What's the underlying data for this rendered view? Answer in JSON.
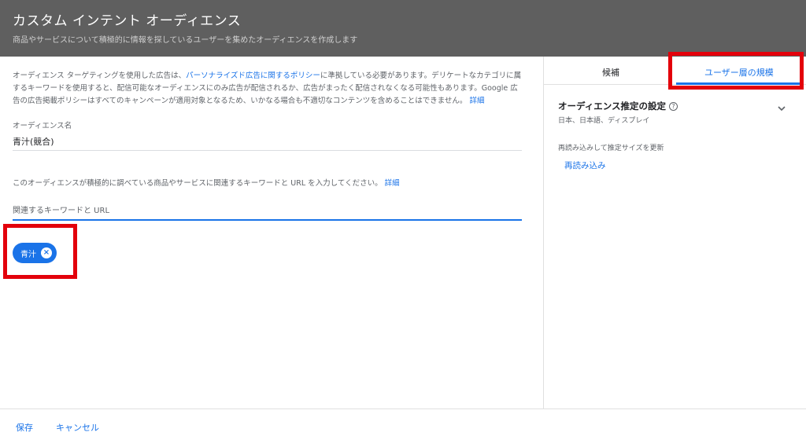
{
  "header": {
    "title": "カスタム インテント オーディエンス",
    "subtitle": "商品やサービスについて積極的に情報を探しているユーザーを集めたオーディエンスを作成します"
  },
  "policy": {
    "text_before": "オーディエンス ターゲティングを使用した広告は、",
    "link": "パーソナライズド広告に関するポリシー",
    "text_after": "に準拠している必要があります。デリケートなカテゴリに属するキーワードを使用すると、配信可能なオーディエンスにのみ広告が配信されるか、広告がまったく配信されなくなる可能性もあります。Google 広告の広告掲載ポリシーはすべてのキャンペーンが適用対象となるため、いかなる場合も不適切なコンテンツを含めることはできません。",
    "details_link": "詳細"
  },
  "audience_name": {
    "label": "オーディエンス名",
    "value": "青汁(競合)"
  },
  "keywords": {
    "instruction": "このオーディエンスが積極的に調べている商品やサービスに関連するキーワードと URL を入力してください。",
    "details_link": "詳細",
    "placeholder": "関連するキーワードと URL",
    "chips": [
      {
        "label": "青汁"
      }
    ]
  },
  "side": {
    "tabs": [
      {
        "label": "候補",
        "active": false
      },
      {
        "label": "ユーザー層の規模",
        "active": true
      }
    ],
    "estimate_title": "オーディエンス推定の設定",
    "estimate_subtitle": "日本、日本語、ディスプレイ",
    "reload_note": "再読み込みして推定サイズを更新",
    "reload_button": "再読み込み"
  },
  "footer": {
    "save": "保存",
    "cancel": "キャンセル"
  },
  "colors": {
    "header_bg": "#5f5f5f",
    "accent": "#1a73e8",
    "highlight": "#e3000b"
  }
}
